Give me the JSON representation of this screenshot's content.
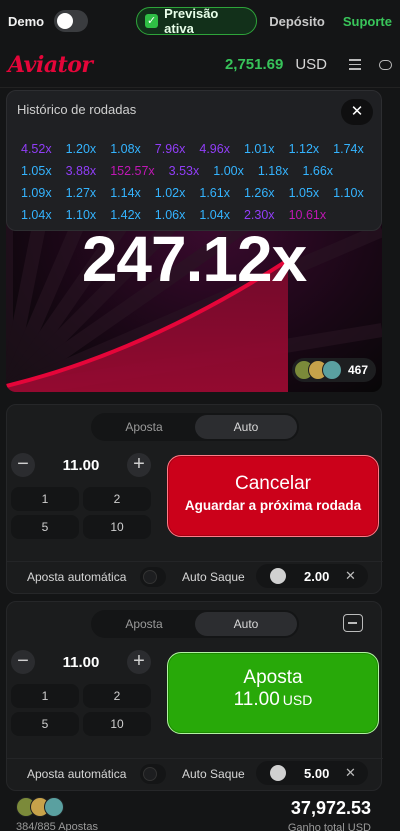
{
  "topbar": {
    "demo_label": "Demo",
    "previsao_label": "Previsão ativa",
    "deposit_label": "Depósito",
    "support_label": "Suporte"
  },
  "header": {
    "logo": "Aviator",
    "balance": "2,751.69",
    "currency": "USD"
  },
  "game": {
    "multiplier": "247.12x",
    "players_count": "467"
  },
  "history": {
    "title": "Histórico de rodadas",
    "close_label": "✕",
    "rows": [
      [
        {
          "v": "4.52x",
          "c": "purple"
        },
        {
          "v": "1.20x",
          "c": "blue"
        },
        {
          "v": "1.08x",
          "c": "blue"
        },
        {
          "v": "7.96x",
          "c": "purple"
        },
        {
          "v": "4.96x",
          "c": "purple"
        },
        {
          "v": "1.01x",
          "c": "blue"
        },
        {
          "v": "1.12x",
          "c": "blue"
        },
        {
          "v": "1.74x",
          "c": "blue"
        }
      ],
      [
        {
          "v": "1.05x",
          "c": "blue"
        },
        {
          "v": "3.88x",
          "c": "purple"
        },
        {
          "v": "152.57x",
          "c": "pink"
        },
        {
          "v": "3.53x",
          "c": "purple"
        },
        {
          "v": "1.00x",
          "c": "blue"
        },
        {
          "v": "1.18x",
          "c": "blue"
        },
        {
          "v": "1.66x",
          "c": "blue"
        }
      ],
      [
        {
          "v": "1.09x",
          "c": "blue"
        },
        {
          "v": "1.27x",
          "c": "blue"
        },
        {
          "v": "1.14x",
          "c": "blue"
        },
        {
          "v": "1.02x",
          "c": "blue"
        },
        {
          "v": "1.61x",
          "c": "blue"
        },
        {
          "v": "1.26x",
          "c": "blue"
        },
        {
          "v": "1.05x",
          "c": "blue"
        },
        {
          "v": "1.10x",
          "c": "blue"
        }
      ],
      [
        {
          "v": "1.04x",
          "c": "blue"
        },
        {
          "v": "1.10x",
          "c": "blue"
        },
        {
          "v": "1.42x",
          "c": "blue"
        },
        {
          "v": "1.06x",
          "c": "blue"
        },
        {
          "v": "1.04x",
          "c": "blue"
        },
        {
          "v": "2.30x",
          "c": "purple"
        },
        {
          "v": "10.61x",
          "c": "pink"
        }
      ]
    ]
  },
  "panel1": {
    "tab_bet": "Aposta",
    "tab_auto": "Auto",
    "amount": "11.00",
    "minus": "−",
    "plus": "+",
    "quick": [
      "1",
      "2",
      "5",
      "10"
    ],
    "button_line1": "Cancelar",
    "button_line2": "Aguardar a próxima rodada",
    "auto_bet_label": "Aposta automática",
    "auto_cashout_label": "Auto Saque",
    "cashout_value": "2.00",
    "cashout_x": "✕"
  },
  "panel2": {
    "tab_bet": "Aposta",
    "tab_auto": "Auto",
    "amount": "11.00",
    "minus": "−",
    "plus": "+",
    "quick": [
      "1",
      "2",
      "5",
      "10"
    ],
    "button_line1": "Aposta",
    "button_amount": "11.00",
    "button_currency": "USD",
    "auto_bet_label": "Aposta automática",
    "auto_cashout_label": "Auto Saque",
    "cashout_value": "5.00",
    "cashout_x": "✕"
  },
  "footer": {
    "bets_count": "384/885 Apostas",
    "total": "37,972.53",
    "total_label": "Ganho total USD"
  },
  "colors": {
    "accent_green": "#28a909",
    "accent_red": "#cb011a",
    "history_blue": "#34b4ff",
    "history_purple": "#913ef8",
    "history_pink": "#c017b4"
  }
}
